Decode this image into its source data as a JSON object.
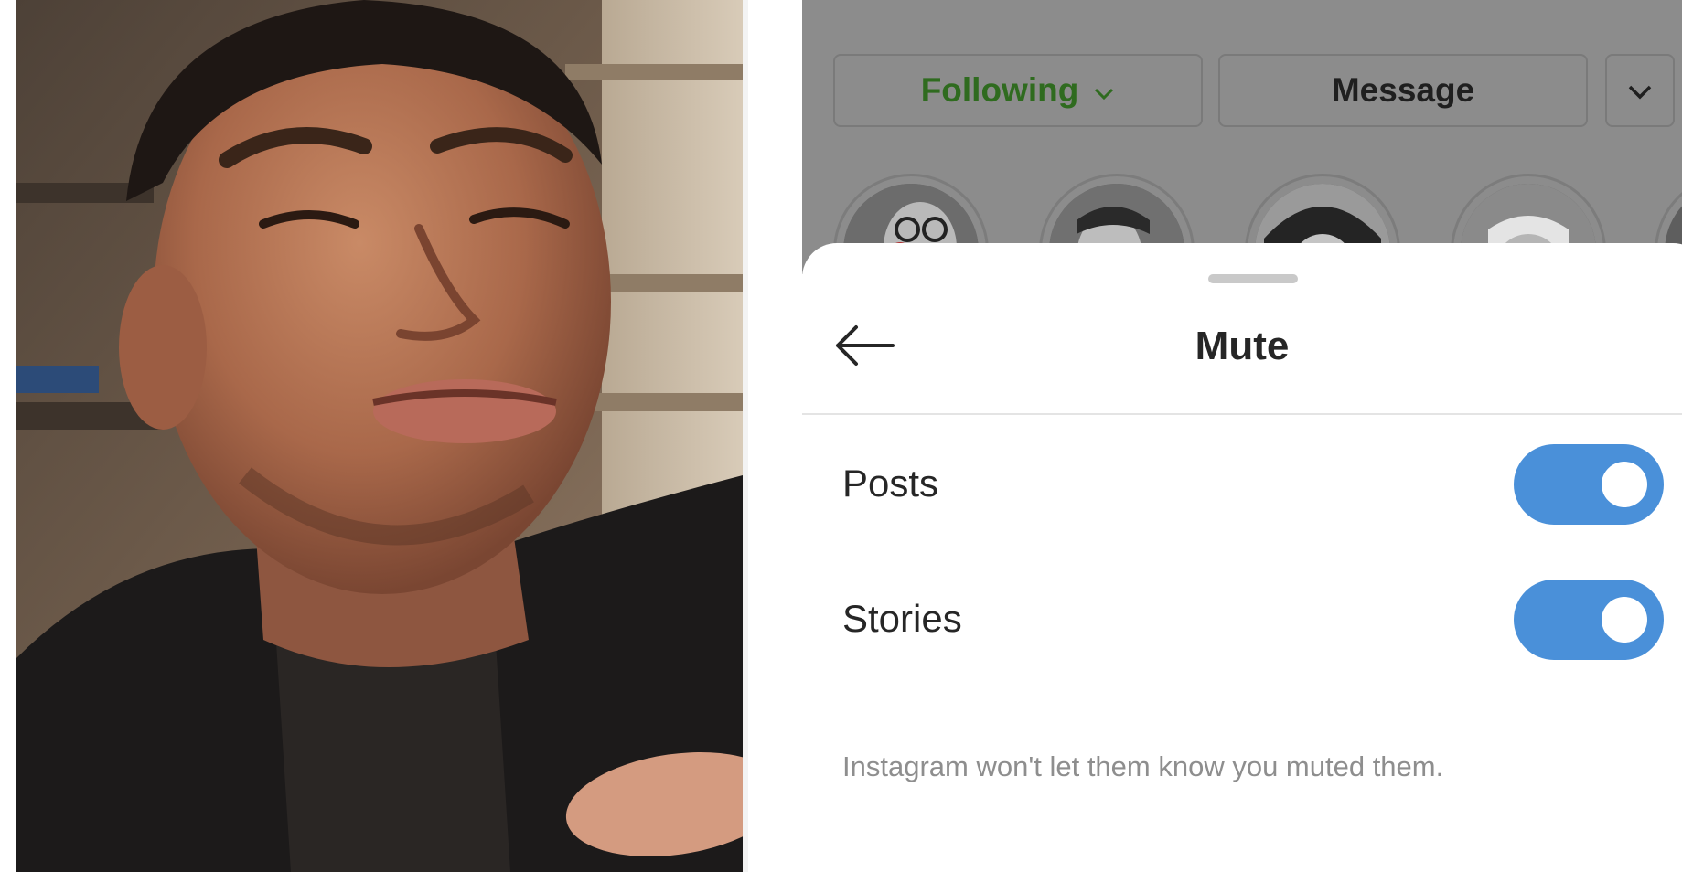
{
  "profile": {
    "following_label": "Following",
    "message_label": "Message",
    "icons": {
      "following_dropdown": "chevron-down-icon",
      "more": "chevron-down-icon"
    },
    "highlight_count": 5
  },
  "mute_sheet": {
    "title": "Mute",
    "back_icon": "arrow-left-icon",
    "options": [
      {
        "label": "Posts",
        "enabled": true
      },
      {
        "label": "Stories",
        "enabled": true
      }
    ],
    "footnote": "Instagram won't let them know you muted them."
  },
  "colors": {
    "toggle_on": "#4a90d9",
    "following_text": "#2f6b1f",
    "overlay": "#8c8c8c"
  }
}
